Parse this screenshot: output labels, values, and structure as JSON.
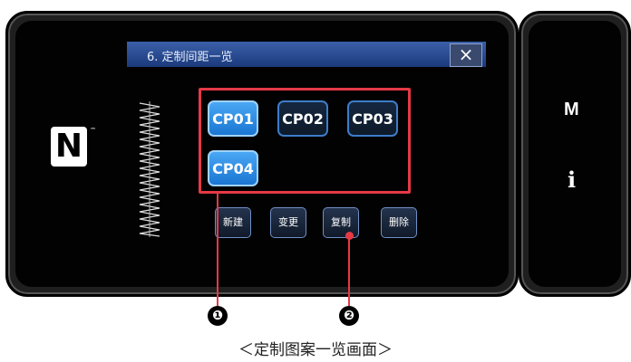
{
  "dialog": {
    "title": "6. 定制间距一览",
    "close_label": "×"
  },
  "patterns": [
    {
      "label": "CP01",
      "selected": true
    },
    {
      "label": "CP02",
      "selected": false
    },
    {
      "label": "CP03",
      "selected": false
    },
    {
      "label": "CP04",
      "selected": true
    }
  ],
  "actions": {
    "new_label": "新建",
    "change_label": "变更",
    "copy_label": "复制",
    "delete_label": "删除"
  },
  "side": {
    "nfc_label": "N",
    "nfc_tm": "™",
    "m_label": "M",
    "info_label": "i"
  },
  "callouts": {
    "marker1": "❶",
    "marker2": "❷"
  },
  "caption": "＜定制图案一览画面＞",
  "colors": {
    "highlight": "#e53945",
    "selected_button": "#2f8be6",
    "titlebar": "#2a4a8e"
  }
}
